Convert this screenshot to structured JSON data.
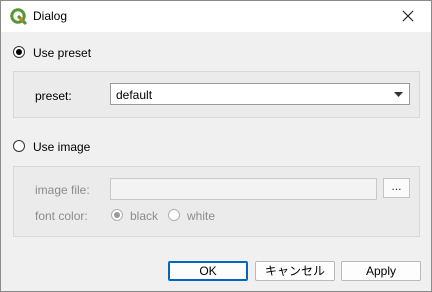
{
  "window": {
    "title": "Dialog",
    "icon": "qgis-logo-icon"
  },
  "preset_option": {
    "label": "Use preset",
    "checked": true
  },
  "preset": {
    "label": "preset:",
    "value": "default"
  },
  "image_option": {
    "label": "Use image",
    "checked": false
  },
  "image_file": {
    "label": "image file:",
    "value": "",
    "browse_label": "..."
  },
  "font_color": {
    "label": "font color:",
    "options": [
      {
        "label": "black",
        "checked": true
      },
      {
        "label": "white",
        "checked": false
      }
    ]
  },
  "buttons": {
    "ok": "OK",
    "cancel": "キャンセル",
    "apply": "Apply"
  },
  "colors": {
    "accent": "#0067c0",
    "qgis_green": "#589632",
    "qgis_yellow": "#ee7913"
  }
}
